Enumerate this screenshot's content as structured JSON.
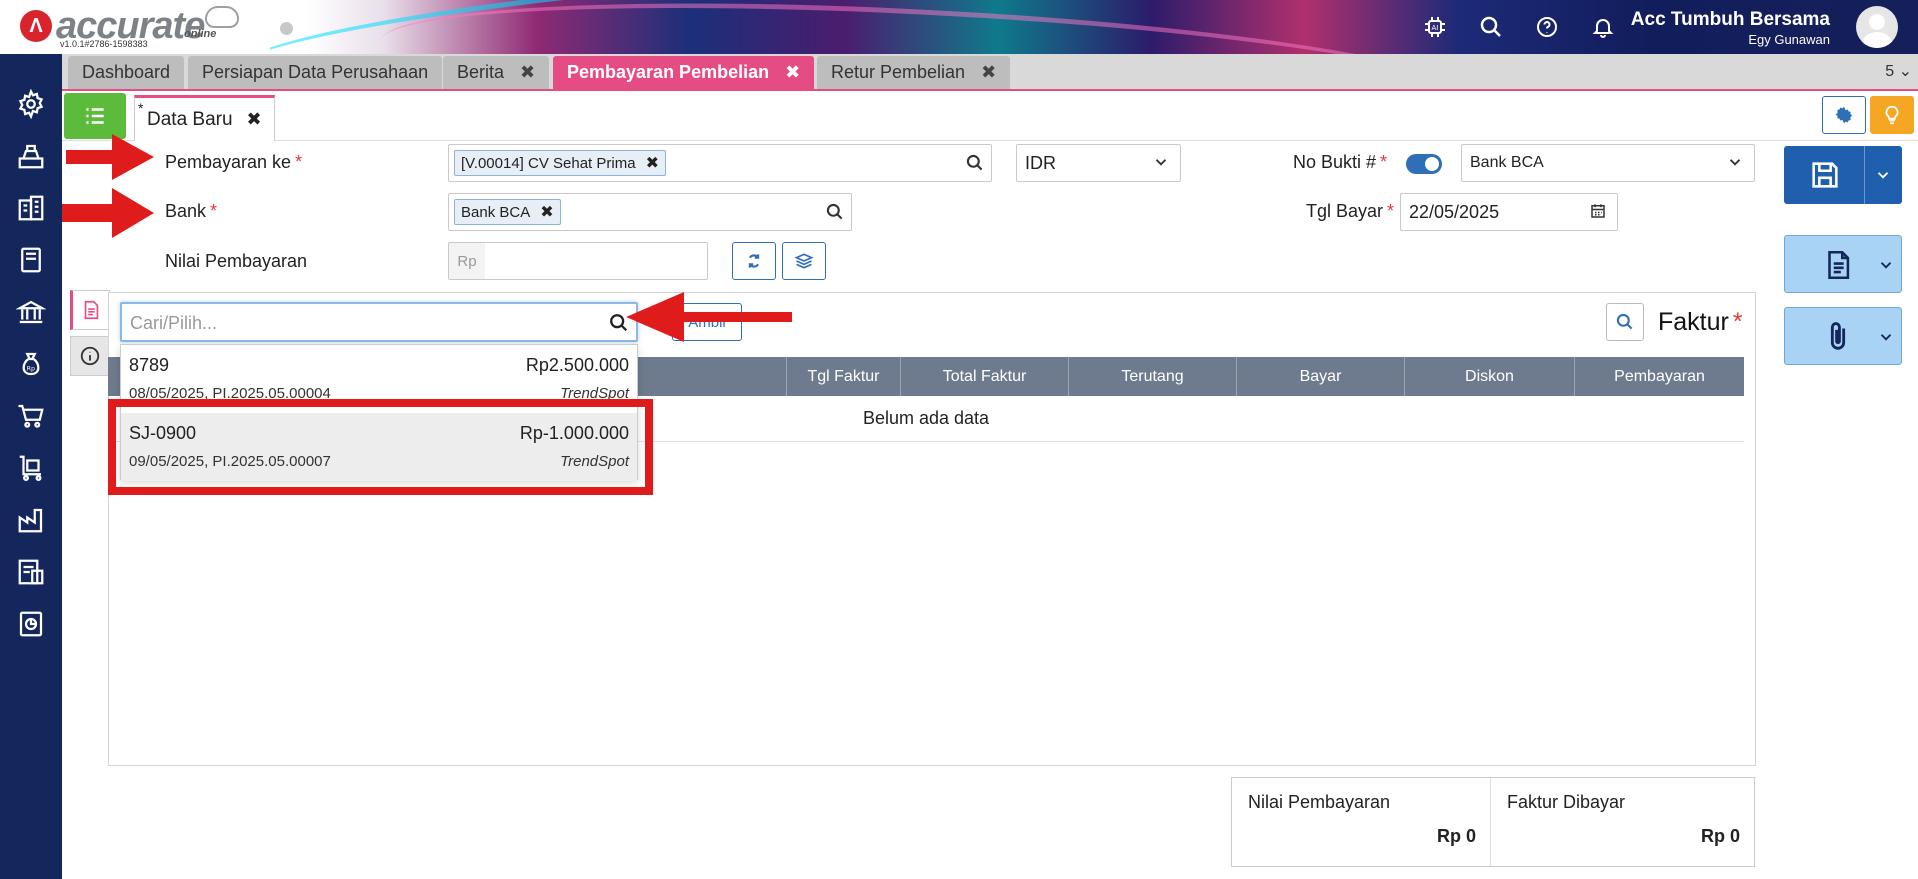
{
  "header": {
    "logo_text": "accurate",
    "logo_online": "online",
    "version": "v1.0.1#2786-1598383",
    "company": "Acc Tumbuh Bersama",
    "user": "Egy Gunawan"
  },
  "tabs": [
    {
      "label": "Dashboard",
      "closable": false
    },
    {
      "label": "Persiapan Data Perusahaan",
      "closable": false
    },
    {
      "label": "Berita",
      "closable": true
    },
    {
      "label": "Pembayaran Pembelian",
      "closable": true,
      "active": true
    },
    {
      "label": "Retur Pembelian",
      "closable": true
    }
  ],
  "tab_count": "5",
  "subtab": {
    "star": "*",
    "label": "Data Baru",
    "close": "✖"
  },
  "form": {
    "pembayaran_ke_label": "Pembayaran ke",
    "pembayaran_ke_value": "[V.00014] CV Sehat Prima",
    "currency": "IDR",
    "bank_label": "Bank",
    "bank_value": "Bank BCA",
    "nilai_label": "Nilai Pembayaran",
    "nilai_prefix": "Rp",
    "no_bukti_label": "No Bukti #",
    "no_bukti_value": "Bank BCA",
    "tgl_bayar_label": "Tgl Bayar",
    "tgl_bayar_value": "22/05/2025",
    "required_mark": "*"
  },
  "invoice": {
    "ambil_label": "Ambil",
    "title": "Faktur",
    "columns": [
      "Tgl Faktur",
      "Total Faktur",
      "Terutang",
      "Bayar",
      "Diskon",
      "Pembayaran"
    ],
    "empty_text": "Belum ada data"
  },
  "dropdown": {
    "placeholder": "Cari/Pilih...",
    "items": [
      {
        "code": "8789",
        "amount": "Rp2.500.000",
        "detail": "08/05/2025, PI.2025.05.00004",
        "vendor": "TrendSpot"
      },
      {
        "code": "SJ-0900",
        "amount": "Rp-1.000.000",
        "detail": "09/05/2025, PI.2025.05.00007",
        "vendor": "TrendSpot"
      }
    ]
  },
  "totals": {
    "nilai_label": "Nilai Pembayaran",
    "nilai_value": "Rp 0",
    "faktur_label": "Faktur Dibayar",
    "faktur_value": "Rp 0"
  },
  "colors": {
    "accent": "#e54c84",
    "primary": "#1f5fad",
    "sidebar": "#14275c",
    "annotation": "#e01b1b"
  }
}
